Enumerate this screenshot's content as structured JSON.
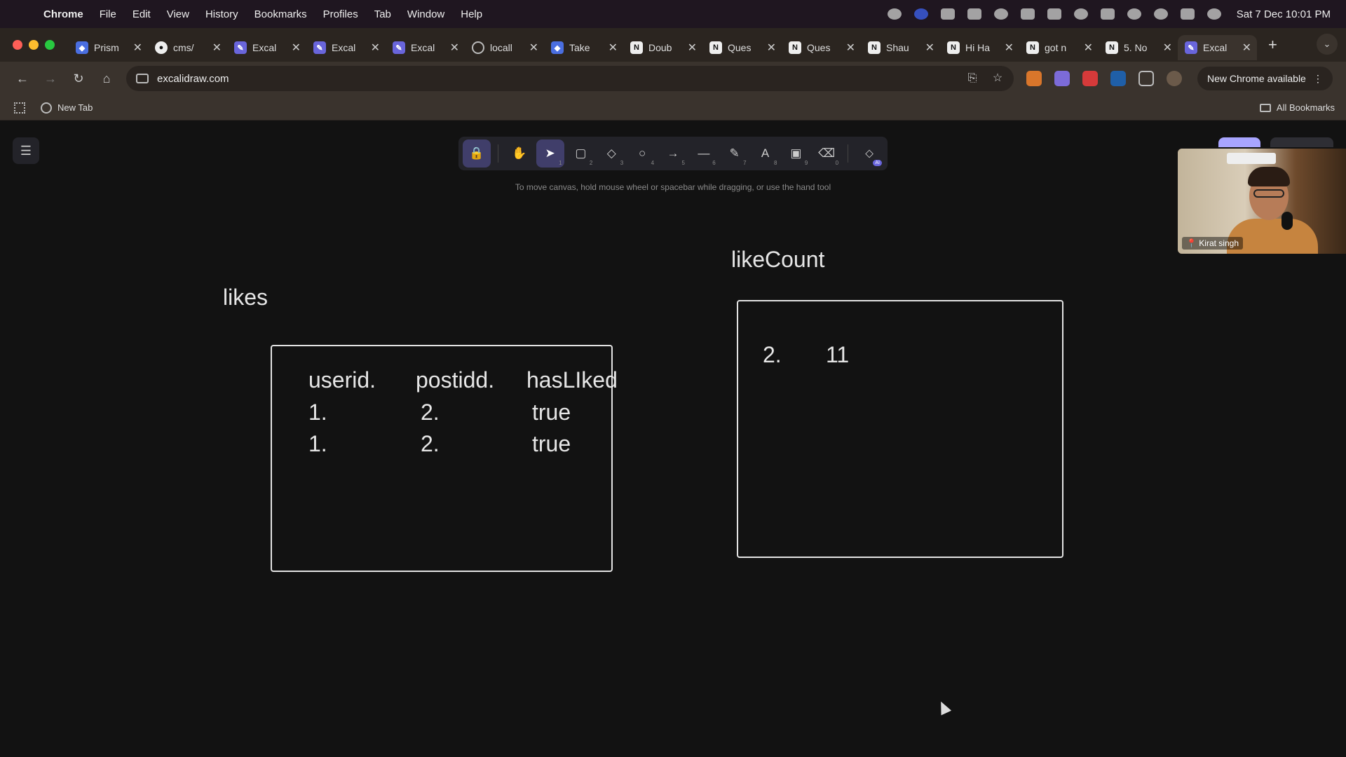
{
  "menubar": {
    "items": [
      "Chrome",
      "File",
      "Edit",
      "View",
      "History",
      "Bookmarks",
      "Profiles",
      "Tab",
      "Window",
      "Help"
    ],
    "clock": "Sat 7 Dec  10:01 PM"
  },
  "tabs": [
    {
      "title": "Prism",
      "favicon": "prisma-icon"
    },
    {
      "title": "cms/",
      "favicon": "github-icon"
    },
    {
      "title": "Excal",
      "favicon": "excalidraw-icon"
    },
    {
      "title": "Excal",
      "favicon": "excalidraw-icon"
    },
    {
      "title": "Excal",
      "favicon": "excalidraw-icon"
    },
    {
      "title": "locall",
      "favicon": "globe-icon"
    },
    {
      "title": "Take",
      "favicon": "prisma-icon"
    },
    {
      "title": "Doub",
      "favicon": "notion-icon"
    },
    {
      "title": "Ques",
      "favicon": "notion-icon"
    },
    {
      "title": "Ques",
      "favicon": "notion-icon"
    },
    {
      "title": "Shau",
      "favicon": "notion-icon"
    },
    {
      "title": "Hi Ha",
      "favicon": "notion-icon"
    },
    {
      "title": "got n",
      "favicon": "notion-icon"
    },
    {
      "title": "5. No",
      "favicon": "notion-icon"
    },
    {
      "title": "Excal",
      "favicon": "excalidraw-icon",
      "active": true
    }
  ],
  "toolbar": {
    "url": "excalidraw.com",
    "update_label": "New Chrome available"
  },
  "bookmarks": {
    "items": [
      "New Tab"
    ],
    "all_label": "All Bookmarks"
  },
  "excalidraw": {
    "hint": "To move canvas, hold mouse wheel or spacebar while dragging, or use the hand tool",
    "tools": [
      {
        "name": "lock-icon",
        "key": ""
      },
      {
        "name": "hand-icon",
        "key": ""
      },
      {
        "name": "selection-icon",
        "key": "1"
      },
      {
        "name": "rectangle-icon",
        "key": "2"
      },
      {
        "name": "diamond-icon",
        "key": "3"
      },
      {
        "name": "ellipse-icon",
        "key": "4"
      },
      {
        "name": "arrow-icon",
        "key": "5"
      },
      {
        "name": "line-icon",
        "key": "6"
      },
      {
        "name": "pencil-icon",
        "key": "7"
      },
      {
        "name": "text-icon",
        "key": "8"
      },
      {
        "name": "image-icon",
        "key": "9"
      },
      {
        "name": "eraser-icon",
        "key": "0"
      }
    ],
    "likes": {
      "label": "likes",
      "headers": [
        "userid.",
        "postidd.",
        "hasLIked"
      ],
      "rows": [
        [
          "1.",
          "2.",
          "true"
        ],
        [
          "1.",
          "2.",
          "true"
        ]
      ]
    },
    "likeCount": {
      "label": "likeCount",
      "row": [
        "2.",
        "11"
      ]
    }
  },
  "webcam": {
    "name": "Kirat singh"
  },
  "colors": {
    "canvas": "#121212",
    "accent": "#6965db",
    "stroke": "#e3e3e3"
  }
}
